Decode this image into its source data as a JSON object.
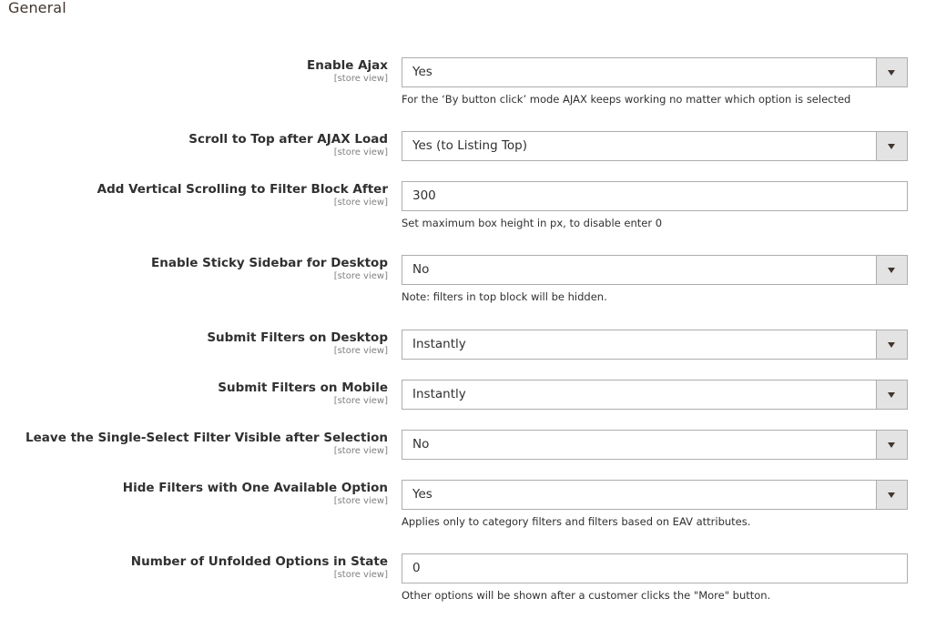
{
  "section": {
    "title": "General"
  },
  "fields": [
    {
      "label": "Enable Ajax",
      "scope": "[store view]",
      "type": "select",
      "value": "Yes",
      "note": "For the ‘By button click’ mode AJAX keeps working no matter which option is selected"
    },
    {
      "label": "Scroll to Top after AJAX Load",
      "scope": "[store view]",
      "type": "select",
      "value": "Yes (to Listing Top)",
      "note": ""
    },
    {
      "label": "Add Vertical Scrolling to Filter Block After",
      "scope": "[store view]",
      "type": "text",
      "value": "300",
      "note": "Set maximum box height in px, to disable enter 0"
    },
    {
      "label": "Enable Sticky Sidebar for Desktop",
      "scope": "[store view]",
      "type": "select",
      "value": "No",
      "note": "Note: filters in top block will be hidden."
    },
    {
      "label": "Submit Filters on Desktop",
      "scope": "[store view]",
      "type": "select",
      "value": "Instantly",
      "note": ""
    },
    {
      "label": "Submit Filters on Mobile",
      "scope": "[store view]",
      "type": "select",
      "value": "Instantly",
      "note": ""
    },
    {
      "label": "Leave the Single-Select Filter Visible after Selection",
      "scope": "[store view]",
      "type": "select",
      "value": "No",
      "note": ""
    },
    {
      "label": "Hide Filters with One Available Option",
      "scope": "[store view]",
      "type": "select",
      "value": "Yes",
      "note": "Applies only to category filters and filters based on EAV attributes."
    },
    {
      "label": "Number of Unfolded Options in State",
      "scope": "[store view]",
      "type": "text",
      "value": "0",
      "note": "Other options will be shown after a customer clicks the \"More\" button."
    }
  ],
  "icons": {
    "select_arrow": "caret-down-icon"
  }
}
